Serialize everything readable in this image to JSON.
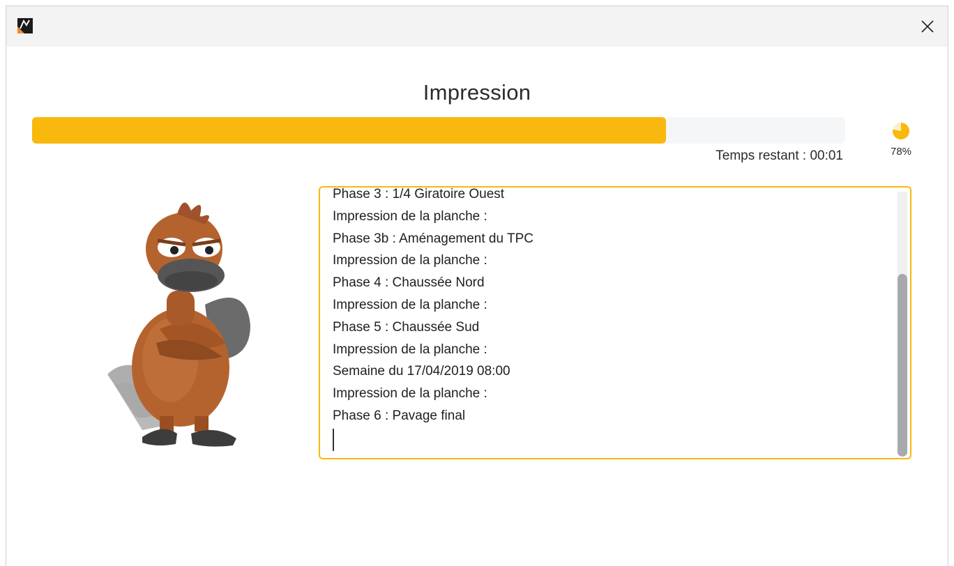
{
  "window": {
    "app_icon": "pm-app-icon",
    "close_icon": "close-icon"
  },
  "dialog": {
    "title": "Impression",
    "progress_fraction": 0.78,
    "remaining_label": "Temps restant :  00:01",
    "percent_label": "78%",
    "progress_color": "#f9b80d",
    "accent_color": "#f9b80d"
  },
  "log": {
    "lines": [
      "Phase 3 : 1/4 Giratoire Ouest",
      "Impression de la planche :",
      "Phase 3b : Aménagement du TPC",
      "Impression de la planche :",
      "Phase 4 : Chaussée Nord",
      "Impression de la planche :",
      "Phase 5 : Chaussée Sud",
      "Impression de la planche :",
      "Semaine du 17/04/2019 08:00",
      "Impression de la planche :",
      "Phase 6 : Pavage final"
    ]
  }
}
